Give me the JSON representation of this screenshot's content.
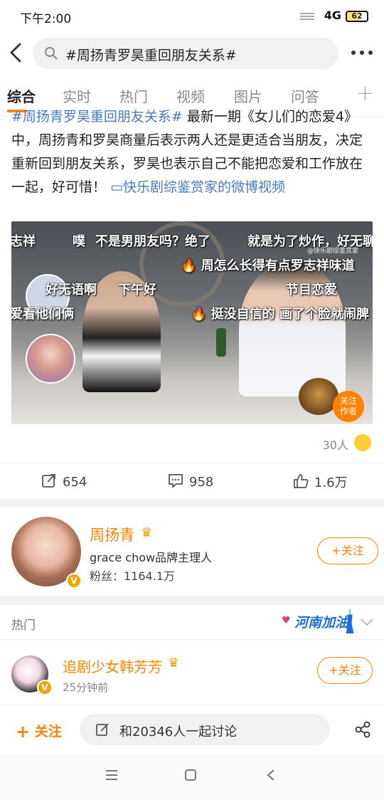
{
  "status_bar": {
    "time": "下午2:00",
    "network": "4G",
    "battery": "62"
  },
  "search": {
    "query": "#周扬青罗昊重回朋友关系#"
  },
  "tabs": [
    {
      "label": "综合",
      "active": true
    },
    {
      "label": "实时"
    },
    {
      "label": "热门"
    },
    {
      "label": "视频"
    },
    {
      "label": "图片"
    },
    {
      "label": "问答"
    }
  ],
  "post": {
    "topic": "#周扬青罗昊重回朋友关系#",
    "text": " 最新一期《女儿们的恋爱4》中，周扬青和罗昊商量后表示两人还是更适合当朋友，决定重新回到朋友关系，罗昊也表示自己不能把恋爱和工作放在一起，好可惜！",
    "link": "快乐剧综鉴赏家的微博视频"
  },
  "video": {
    "danmaku": [
      "志祥",
      "噗",
      "不是男朋友吗？绝了",
      "就是为了炒作，好无聊",
      "周怎么长得有点罗志祥味道",
      "好无语啊",
      "下午好",
      "节目恋爱",
      "爱看他们俩",
      "挺没自信的 画了个脸就闹脾"
    ],
    "watermark": "@快乐剧综鉴赏家",
    "follow_author": [
      "关注",
      "作者"
    ],
    "logo_text": "快乐剧综鉴赏家"
  },
  "likers": {
    "count": "30人"
  },
  "actions": {
    "repost": "654",
    "comment": "958",
    "like": "1.6万"
  },
  "profile": {
    "name": "周扬青",
    "desc": "grace chow品牌主理人",
    "fans": "粉丝：1164.1万",
    "follow": "关注"
  },
  "hot": {
    "label": "热门",
    "banner": "河南加油"
  },
  "recommend": {
    "name": "追剧少女韩芳芳",
    "time": "25分钟前",
    "follow": "关注"
  },
  "bottom": {
    "follow": "关注",
    "discuss": "和20346人一起讨论"
  },
  "colors": {
    "accent": "#ff8200",
    "link": "#4a7ab8",
    "verified": "#f3a200"
  }
}
